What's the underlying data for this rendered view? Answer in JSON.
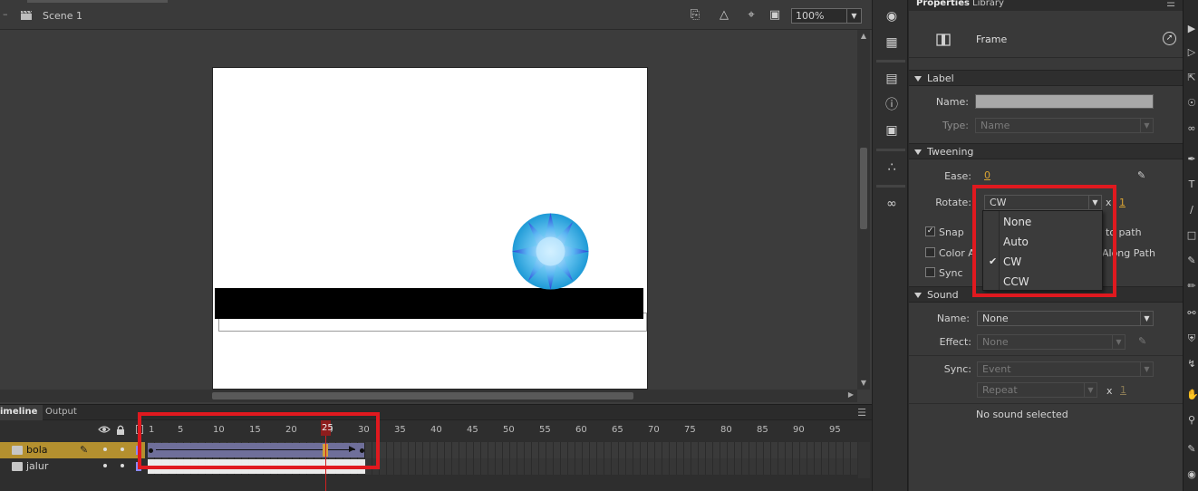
{
  "stage": {
    "scene_label": "Scene 1",
    "zoom_value": "100%",
    "icons": [
      "clapperboard-icon",
      "edit-symbols-icon",
      "snap-icon",
      "center-stage-icon",
      "clip-content-icon"
    ]
  },
  "timeline": {
    "tabs": [
      "imeline",
      "Output"
    ],
    "ruler_numbers": [
      "1",
      "5",
      "10",
      "15",
      "20",
      "25",
      "30",
      "35",
      "40",
      "45",
      "50",
      "55",
      "60",
      "65",
      "70",
      "75",
      "80",
      "85",
      "90",
      "95"
    ],
    "current_frame": 25,
    "total_tween_frames": 30,
    "layers": [
      {
        "name": "bola",
        "selected": true
      },
      {
        "name": "jalur",
        "selected": false
      }
    ]
  },
  "properties": {
    "tabs": {
      "properties": "Properties",
      "library": "Library"
    },
    "frame_title": "Frame",
    "label_section": {
      "header": "Label",
      "name_label": "Name:",
      "name_value": "",
      "type_label": "Type:",
      "type_value": "Name"
    },
    "tweening_section": {
      "header": "Tweening",
      "ease_label": "Ease:",
      "ease_value": "0",
      "rotate_label": "Rotate:",
      "rotate_value": "CW",
      "rotate_times_x": "x",
      "rotate_times_value": "1",
      "snap_label": "Snap",
      "color_along_label": "Color A",
      "sync_label": "Sync",
      "orient_to_path_partial": "to path",
      "scale_along_path_partial": "Along Path"
    },
    "rotate_menu": {
      "options": [
        "None",
        "Auto",
        "CW",
        "CCW"
      ],
      "checked": "CW"
    },
    "sound_section": {
      "header": "Sound",
      "name_label": "Name:",
      "name_value": "None",
      "effect_label": "Effect:",
      "effect_value": "None",
      "sync_label": "Sync:",
      "sync_value": "Event",
      "repeat_value": "Repeat",
      "repeat_x": "x",
      "repeat_count": "1",
      "status": "No sound selected"
    }
  },
  "colors": {
    "highlight_red": "#e0191f",
    "selected_layer": "#b4902f",
    "tween_span": "#6f6f9a",
    "value_orange": "#d9a433"
  }
}
